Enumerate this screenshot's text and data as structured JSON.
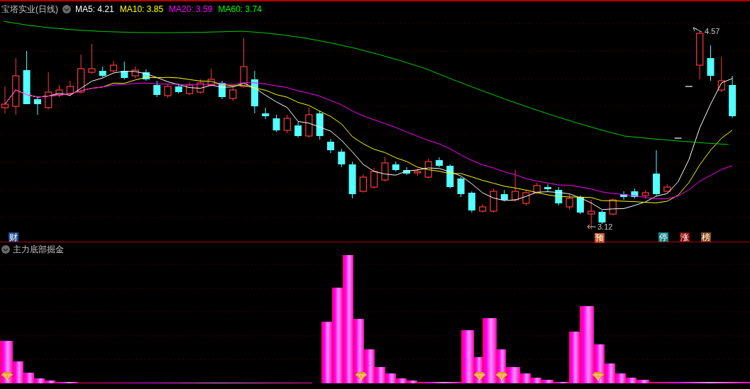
{
  "chart": {
    "title": "宝塔实业(日线)",
    "indicators": [
      {
        "label": "MA5: 4.21",
        "color": "#ffffff"
      },
      {
        "label": "MA10: 3.85",
        "color": "#ffff00"
      },
      {
        "label": "MA20: 3.59",
        "color": "#ff00ff"
      },
      {
        "label": "MA60: 3.74",
        "color": "#00ff00"
      }
    ],
    "high_label": "4.57",
    "low_label": "3.12",
    "markers": [
      {
        "text": "财",
        "color": "#1f4e9c"
      },
      {
        "text": "预",
        "color": "#c8561a"
      },
      {
        "text": "停",
        "color": "#13878f"
      },
      {
        "text": "涨",
        "color": "#8a0a0a"
      },
      {
        "text": "榜",
        "color": "#8a4a14"
      }
    ]
  },
  "indicator_panel": {
    "title": "主力底部掘金"
  }
}
